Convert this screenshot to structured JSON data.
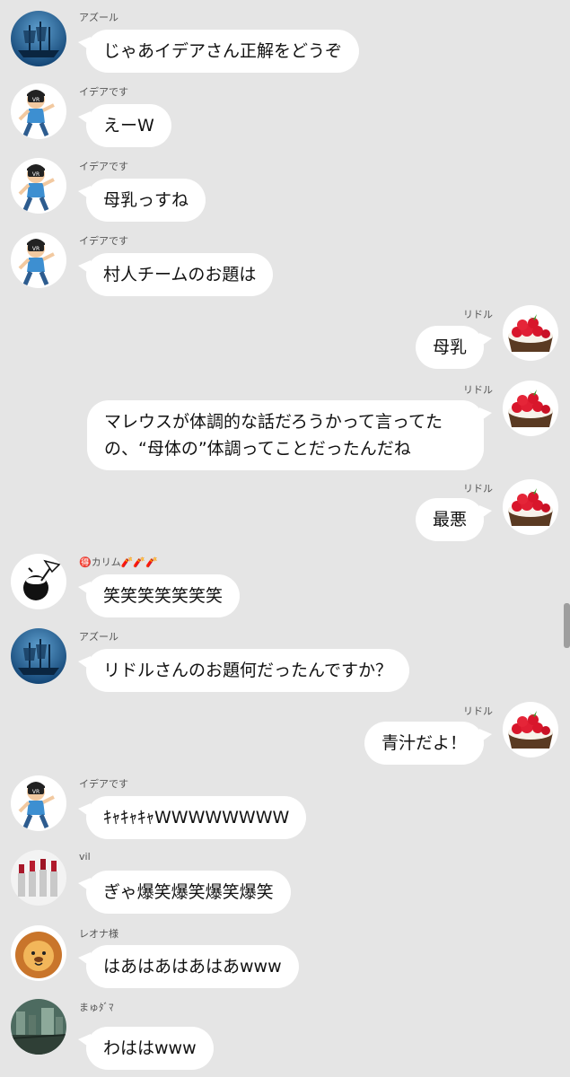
{
  "messages": [
    {
      "sender": "アズール",
      "side": "left",
      "avatar": "ship",
      "text": "じゃあイデアさん正解をどうぞ"
    },
    {
      "sender": "イデアです",
      "side": "left",
      "avatar": "vr",
      "text": "えーW"
    },
    {
      "sender": "イデアです",
      "side": "left",
      "avatar": "vr",
      "text": "母乳っすね"
    },
    {
      "sender": "イデアです",
      "side": "left",
      "avatar": "vr",
      "text": "村人チームのお題は"
    },
    {
      "sender": "リドル",
      "side": "right",
      "avatar": "tart",
      "text": "母乳"
    },
    {
      "sender": "リドル",
      "side": "right",
      "avatar": "tart",
      "text": "マレウスが体調的な話だろうかって言ってたの、“母体の”体調ってことだったんだね"
    },
    {
      "sender": "リドル",
      "side": "right",
      "avatar": "tart",
      "text": "最悪"
    },
    {
      "sender": "🉐カリム🧨🧨🧨",
      "side": "left",
      "avatar": "coconut",
      "text": "笑笑笑笑笑笑笑"
    },
    {
      "sender": "アズール",
      "side": "left",
      "avatar": "ship",
      "text": "リドルさんのお題何だったんですか？"
    },
    {
      "sender": "リドル",
      "side": "right",
      "avatar": "tart",
      "text": "青汁だよ！"
    },
    {
      "sender": "イデアです",
      "side": "left",
      "avatar": "vr",
      "text": "ｷｬｷｬｷｬWWWWWWWW"
    },
    {
      "sender": "vil",
      "side": "left",
      "avatar": "lipsticks",
      "text": "ぎゃ爆笑爆笑爆笑爆笑"
    },
    {
      "sender": "レオナ様",
      "side": "left",
      "avatar": "lion",
      "text": "はあはあはあはあwww"
    },
    {
      "sender": "まゅﾀﾞﾏ",
      "side": "left",
      "avatar": "ruins",
      "text": "わははwww"
    }
  ],
  "colors": {
    "background": "#e5e5e5",
    "bubble": "#ffffff"
  }
}
